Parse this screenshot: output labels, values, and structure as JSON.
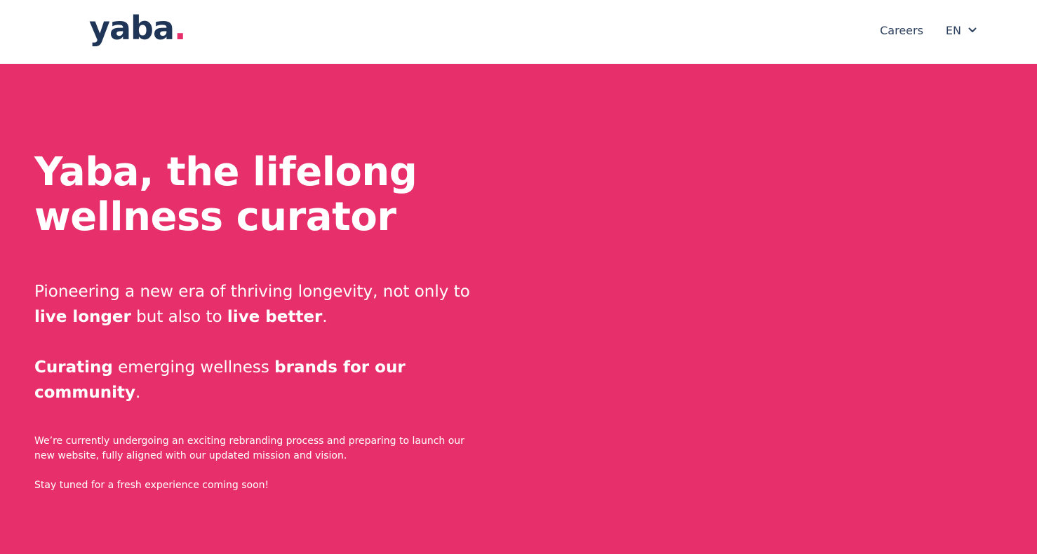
{
  "header": {
    "logo_text": "yaba",
    "logo_dot": ".",
    "nav": {
      "careers_label": "Careers",
      "language_label": "EN",
      "language_icon": "chevron-down-icon"
    }
  },
  "hero": {
    "title": "Yaba, the lifelong wellness curator",
    "lead": {
      "part1": "Pioneering a new era of thriving longevity, not only to ",
      "bold1": "live longer",
      "part2": " but also to ",
      "bold2": "live better",
      "part3": "."
    },
    "curating": {
      "bold1": "Curating",
      "part1": " emerging wellness ",
      "bold2": "brands for our community",
      "part2": "."
    },
    "note": "We’re currently undergoing an exciting rebranding process and preparing to launch our new website, fully aligned with our updated mission and vision.",
    "soon": "Stay tuned for a fresh experience coming soon!"
  },
  "colors": {
    "brand_pink": "#e62f6b",
    "brand_navy": "#1f3557",
    "header_bg": "#ffffff",
    "hero_text": "#ffffff"
  }
}
